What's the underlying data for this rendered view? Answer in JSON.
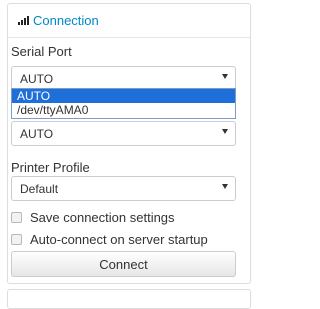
{
  "panel": {
    "title": "Connection",
    "icon": "signal-bars-icon"
  },
  "serial_port": {
    "label": "Serial Port",
    "selected": "AUTO",
    "options": [
      "AUTO",
      "/dev/ttyAMA0"
    ]
  },
  "baudrate": {
    "selected": "AUTO"
  },
  "printer_profile": {
    "label": "Printer Profile",
    "selected": "Default"
  },
  "options": {
    "save_settings": {
      "label": "Save connection settings",
      "checked": false
    },
    "auto_connect": {
      "label": "Auto-connect on server startup",
      "checked": false
    }
  },
  "connect_button": {
    "label": "Connect"
  },
  "colors": {
    "accent": "#0088cc",
    "selection": "#1e6fd9"
  }
}
